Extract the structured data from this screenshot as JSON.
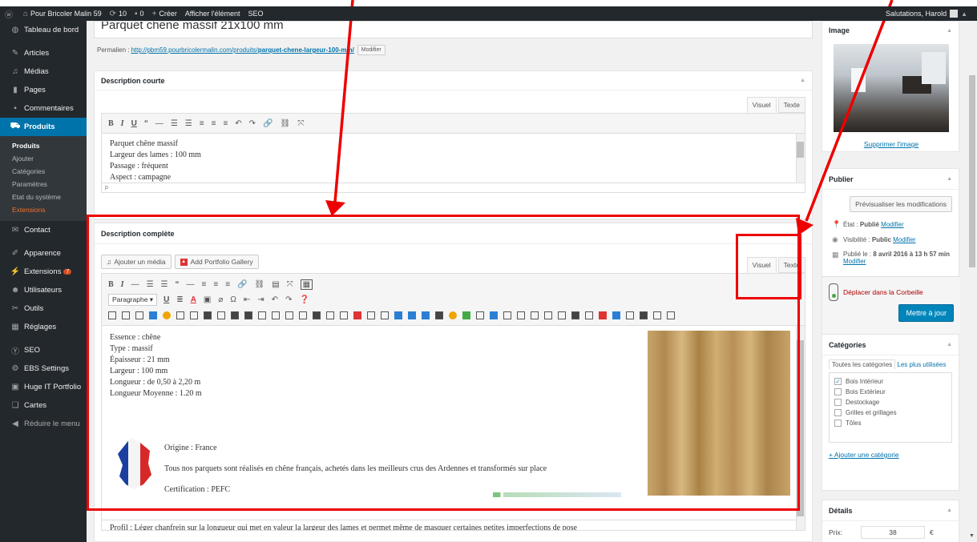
{
  "adminbar": {
    "site_name": "Pour Bricoler Malin 59",
    "updates_count": "10",
    "comments_count": "0",
    "new_label": "Créer",
    "view_label": "Afficher l'élément",
    "seo_label": "SEO",
    "greeting": "Salutations, Harold"
  },
  "sidebar": {
    "dashboard": "Tableau de bord",
    "posts": "Articles",
    "media": "Médias",
    "pages": "Pages",
    "comments": "Commentaires",
    "products": "Produits",
    "sub": [
      "Produits",
      "Ajouter",
      "Catégories",
      "Paramètres",
      "Etat du système",
      "Extensions"
    ],
    "contact": "Contact",
    "appearance": "Apparence",
    "plugins": "Extensions",
    "plugins_badge": "7",
    "users": "Utilisateurs",
    "tools": "Outils",
    "settings": "Réglages",
    "seo": "SEO",
    "ebs": "EBS Settings",
    "huge": "Huge IT Portfolio",
    "maps": "Cartes",
    "collapse": "Réduire le menu"
  },
  "post": {
    "title": "Parquet chêne massif 21x100 mm",
    "permalink_label": "Permalien :",
    "permalink_base": "http://pbm59.pourbricolermalin.com/produits/",
    "permalink_slug": "parquet-chene-largeur-100-mm/",
    "edit_btn": "Modifier"
  },
  "short_desc": {
    "heading": "Description courte",
    "tab_visual": "Visuel",
    "tab_text": "Texte",
    "lines": [
      "Parquet chêne massif",
      "Largeur des lames : 100 mm",
      "Passage : fréquent",
      "Aspect : campagne"
    ],
    "path": "p"
  },
  "full_desc": {
    "heading": "Description complète",
    "add_media": "Ajouter un média",
    "add_portfolio": "Add Portfolio Gallery",
    "tab_visual": "Visuel",
    "tab_text": "Texte",
    "format_select": "Paragraphe",
    "lines": [
      "Essence : chêne",
      "Type : massif",
      "Épaisseur : 21 mm",
      "Largeur : 100 mm",
      "Longueur : de 0,50 à 2,20 m",
      "Longueur Moyenne : 1.20 m"
    ],
    "origin": "Origine : France",
    "origin_text": "Tous nos parquets sont réalisés en chêne français, achetés dans les meilleurs crus des Ardennes et transformés sur place",
    "certification": "Certification : PEFC",
    "profile": "Profil : Léger chanfrein sur la longueur qui met en valeur la largeur des lames et permet même de masquer certaines petites imperfections de pose"
  },
  "image_box": {
    "heading": "Image",
    "remove_link": "Supprimer l'image"
  },
  "publish": {
    "heading": "Publier",
    "preview_btn": "Prévisualiser les modifications",
    "status_label": "État :",
    "status_value": "Publié",
    "visibility_label": "Visibilité :",
    "visibility_value": "Public",
    "published_label": "Publié le :",
    "published_value": "8 avril 2016 à 13 h 57 min",
    "edit_link": "Modifier",
    "trash_link": "Déplacer dans la Corbeille",
    "update_btn": "Mettre à jour"
  },
  "categories": {
    "heading": "Catégories",
    "tab_all": "Toutes les catégories",
    "tab_popular": "Les plus utilisées",
    "items": [
      {
        "label": "Bois Intérieur",
        "checked": true
      },
      {
        "label": "Bois Extérieur",
        "checked": false
      },
      {
        "label": "Destockage",
        "checked": false
      },
      {
        "label": "Grilles et grillages",
        "checked": false
      },
      {
        "label": "Tôles",
        "checked": false
      }
    ],
    "add_link": "+ Ajouter une catégorie"
  },
  "details": {
    "heading": "Détails",
    "price_label": "Prix:",
    "price_value": "38",
    "currency": "€"
  },
  "colors": {
    "annotation": "#e00000",
    "accent": "#0073aa",
    "adminbar": "#23282d"
  }
}
